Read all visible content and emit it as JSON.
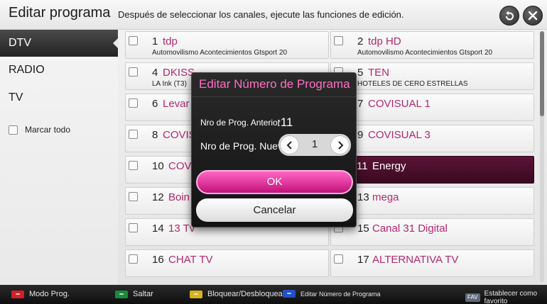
{
  "header": {
    "title": "Editar programa",
    "subtitle": "Después de seleccionar los canales, ejecute las funciones de edición."
  },
  "sidebar": {
    "items": [
      {
        "label": "DTV",
        "active": true
      },
      {
        "label": "RADIO",
        "active": false
      },
      {
        "label": "TV",
        "active": false
      }
    ],
    "mark_all_label": "Marcar todo"
  },
  "channels": [
    {
      "num": "1",
      "name": "tdp",
      "desc": "Automovilismo Acontecimientos Gtsport 20"
    },
    {
      "num": "2",
      "name": "tdp HD",
      "desc": "Automovilismo Acontecimientos Gtsport 20"
    },
    {
      "num": "4",
      "name": "DKISS",
      "desc": "LA Ink (T3)"
    },
    {
      "num": "5",
      "name": "TEN",
      "desc": "HOTELES DE CERO ESTRELLAS"
    },
    {
      "num": "6",
      "name": "Levar",
      "desc": ""
    },
    {
      "num": "7",
      "name": "COVISUAL 1",
      "desc": ""
    },
    {
      "num": "8",
      "name": "COVIS",
      "desc": ""
    },
    {
      "num": "9",
      "name": "COVISUAL 3",
      "desc": ""
    },
    {
      "num": "10",
      "name": "COV",
      "desc": ""
    },
    {
      "num": "11",
      "name": "Energy",
      "desc": "",
      "highlight": true
    },
    {
      "num": "12",
      "name": "Boin",
      "desc": ""
    },
    {
      "num": "13",
      "name": "mega",
      "desc": ""
    },
    {
      "num": "14",
      "name": "13 Tv",
      "desc": ""
    },
    {
      "num": "15",
      "name": "Canal 31 Digital",
      "desc": ""
    },
    {
      "num": "16",
      "name": "CHAT TV",
      "desc": ""
    },
    {
      "num": "17",
      "name": "ALTERNATIVA TV",
      "desc": ""
    }
  ],
  "dialog": {
    "title": "Editar Número de Programa",
    "prev_label": "Nro de Prog. Anterior",
    "prev_value": ":11",
    "new_label": "Nro de Prog. Nuevo",
    "new_value": "1",
    "ok_label": "OK",
    "cancel_label": "Cancelar"
  },
  "footer": {
    "hints": [
      {
        "label": "Modo Prog.",
        "color": "#d0202a"
      },
      {
        "label": "Saltar",
        "color": "#1a8a3a"
      },
      {
        "label": "Bloquear/Desbloquear",
        "color": "#d8b21a"
      },
      {
        "label": "Editar Número de Programa",
        "color": "#2450c8"
      }
    ],
    "fav_key": "FAV",
    "fav_label": "Establecer como favorito"
  },
  "icons": {
    "back": "back-arrow-icon",
    "close": "close-icon",
    "stepper_prev": "chevron-left-icon",
    "stepper_next": "chevron-right-icon"
  }
}
